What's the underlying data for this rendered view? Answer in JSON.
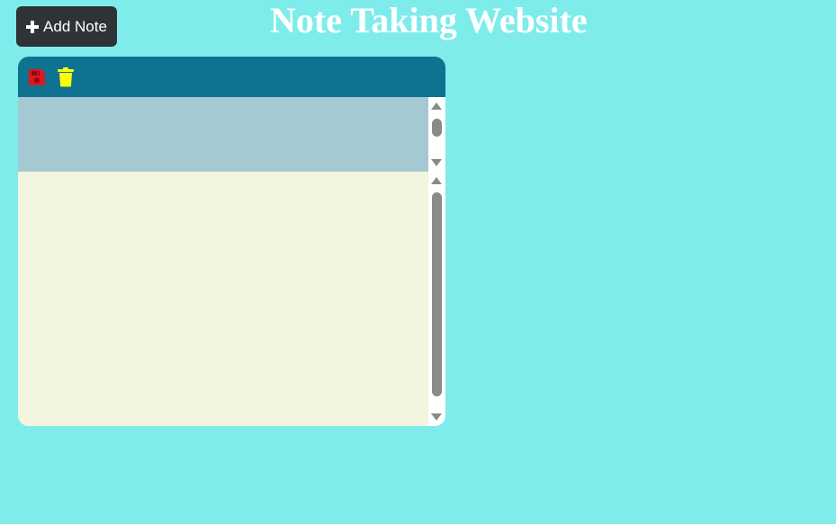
{
  "header": {
    "add_note_label": "Add Note",
    "title": "Note Taking Website"
  },
  "note": {
    "title_text": "",
    "body_text": "",
    "toolbar": {
      "save_icon": "save-icon",
      "delete_icon": "trash-icon"
    }
  },
  "colors": {
    "background": "#7fecec",
    "button": "#2f3336",
    "toolbar": "#0e7391",
    "title_area": "#a4c9d2",
    "body_area": "#f4f5de",
    "save_icon": "#e0161e",
    "delete_icon": "#ffff00"
  }
}
